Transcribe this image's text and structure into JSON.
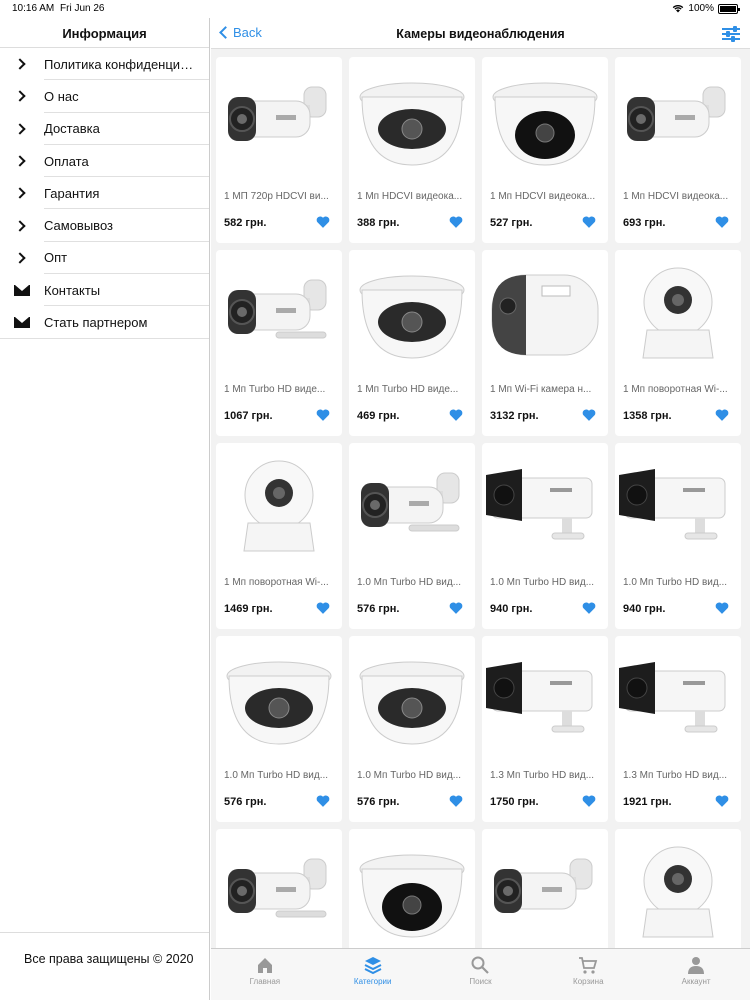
{
  "status": {
    "time": "10:16 AM",
    "date": "Fri Jun 26",
    "battery": "100%"
  },
  "sidebar": {
    "title": "Информация",
    "items": [
      {
        "label": "Политика конфиденциа...",
        "icon": "chevron-right-icon"
      },
      {
        "label": "О нас",
        "icon": "chevron-right-icon"
      },
      {
        "label": "Доставка",
        "icon": "chevron-right-icon"
      },
      {
        "label": "Оплата",
        "icon": "chevron-right-icon"
      },
      {
        "label": "Гарантия",
        "icon": "chevron-right-icon"
      },
      {
        "label": "Самовывоз",
        "icon": "chevron-right-icon"
      },
      {
        "label": "Опт",
        "icon": "chevron-right-icon"
      },
      {
        "label": "Контакты",
        "icon": "envelope-icon"
      },
      {
        "label": "Стать партнером",
        "icon": "envelope-icon"
      }
    ],
    "copyright": "Все права защищены © 2020"
  },
  "navbar": {
    "back_label": "Back",
    "title": "Камеры видеонаблюдения",
    "filter_icon": "sliders-icon"
  },
  "accent_color": "#2f8fe6",
  "products": [
    {
      "name": "1 МП 720p HDCVI ви...",
      "price": "582 грн.",
      "type": "bullet"
    },
    {
      "name": "1 Мп HDCVI видеока...",
      "price": "388 грн.",
      "type": "dome"
    },
    {
      "name": "1 Мп HDCVI видеока...",
      "price": "527 грн.",
      "type": "dome-black"
    },
    {
      "name": "1 Мп HDCVI видеока...",
      "price": "693 грн.",
      "type": "bullet"
    },
    {
      "name": "1 Мп Turbo HD виде...",
      "price": "1067 грн.",
      "type": "bullet-long"
    },
    {
      "name": "1 Мп Turbo HD виде...",
      "price": "469 грн.",
      "type": "dome"
    },
    {
      "name": "1 Мп Wi-Fi камера н...",
      "price": "3132 грн.",
      "type": "box"
    },
    {
      "name": "1 Мп поворотная Wi-...",
      "price": "1358 грн.",
      "type": "cube"
    },
    {
      "name": "1 Мп поворотная Wi-...",
      "price": "1469 грн.",
      "type": "cube"
    },
    {
      "name": "1.0 Мп Turbo HD вид...",
      "price": "576 грн.",
      "type": "bullet-long"
    },
    {
      "name": "1.0 Мп Turbo HD вид...",
      "price": "940 грн.",
      "type": "bullet-black"
    },
    {
      "name": "1.0 Мп Turbo HD вид...",
      "price": "940 грн.",
      "type": "bullet-black"
    },
    {
      "name": "1.0 Мп Turbo HD вид...",
      "price": "576 грн.",
      "type": "dome"
    },
    {
      "name": "1.0 Мп Turbo HD вид...",
      "price": "576 грн.",
      "type": "dome"
    },
    {
      "name": "1.3 Мп Turbo HD вид...",
      "price": "1750 грн.",
      "type": "bullet-black"
    },
    {
      "name": "1.3 Мп Turbo HD вид...",
      "price": "1921 грн.",
      "type": "bullet-black"
    },
    {
      "name": "",
      "price": "",
      "type": "bullet-long"
    },
    {
      "name": "",
      "price": "",
      "type": "dome-black"
    },
    {
      "name": "",
      "price": "",
      "type": "bullet"
    },
    {
      "name": "",
      "price": "",
      "type": "cube"
    }
  ],
  "tabs": [
    {
      "label": "Главная",
      "icon": "home-icon",
      "active": false
    },
    {
      "label": "Категории",
      "icon": "layers-icon",
      "active": true
    },
    {
      "label": "Поиск",
      "icon": "search-icon",
      "active": false
    },
    {
      "label": "Корзина",
      "icon": "cart-icon",
      "active": false
    },
    {
      "label": "Аккаунт",
      "icon": "person-icon",
      "active": false
    }
  ]
}
